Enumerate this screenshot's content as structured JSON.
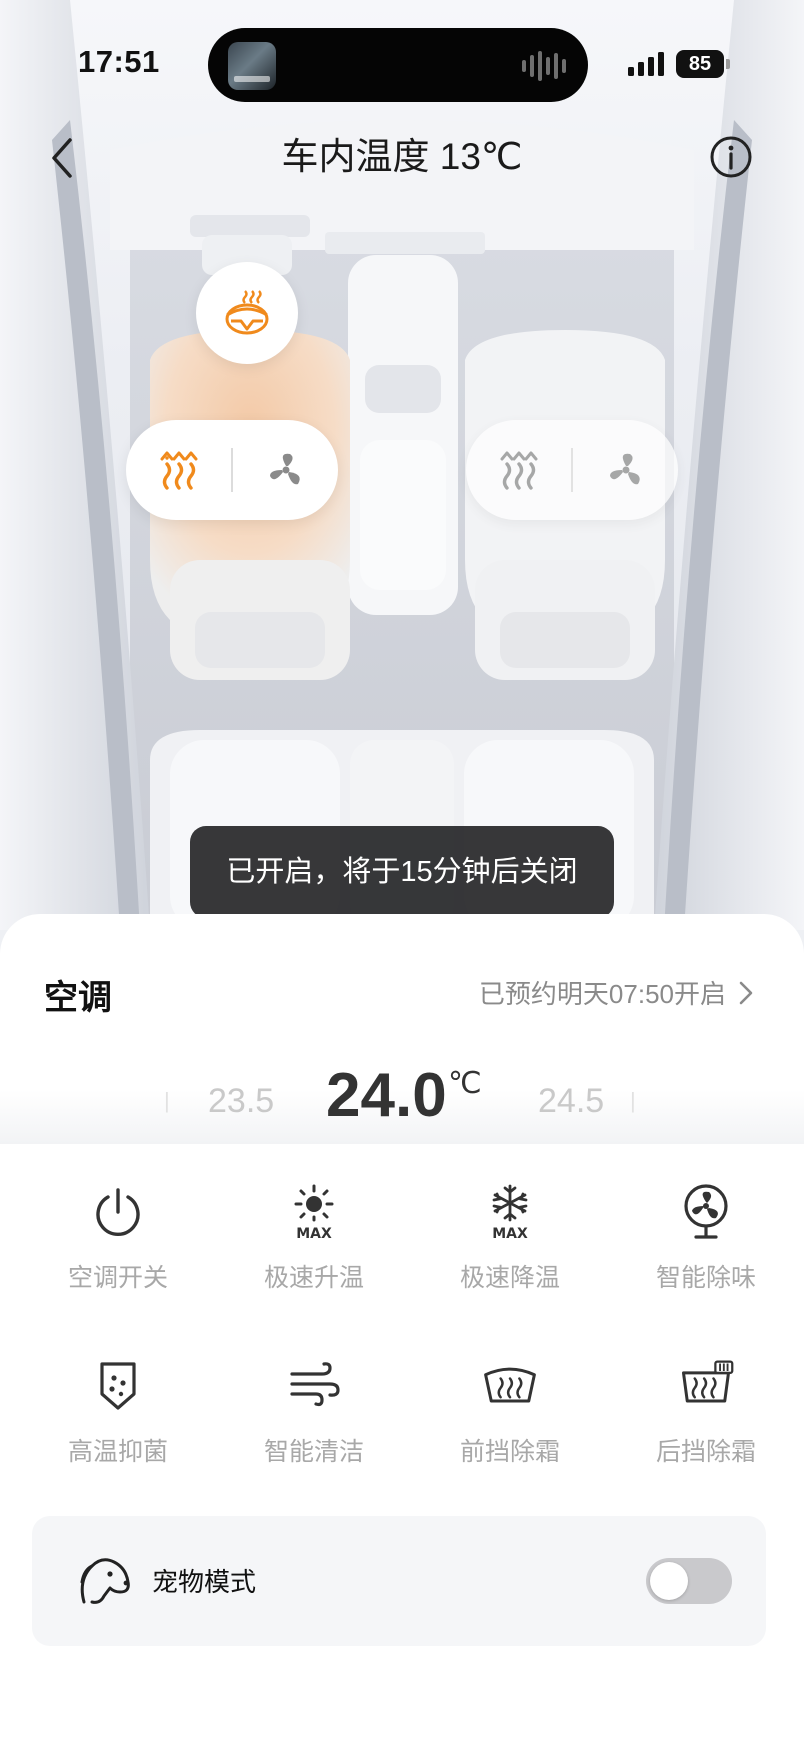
{
  "status_bar": {
    "time": "17:51",
    "battery": "85"
  },
  "header": {
    "title": "车内温度 13℃"
  },
  "toast": {
    "message": "已开启，将于15分钟后关闭"
  },
  "climate": {
    "title": "空调",
    "schedule_text": "已预约明天07:50开启",
    "temperature": {
      "current": "24.0",
      "unit": "℃",
      "lower": "23.5",
      "higher": "24.5"
    },
    "functions": [
      {
        "label": "空调开关",
        "icon": "power-icon"
      },
      {
        "label": "极速升温",
        "icon": "max-heat-icon"
      },
      {
        "label": "极速降温",
        "icon": "max-cool-icon"
      },
      {
        "label": "智能除味",
        "icon": "fan-deodorize-icon"
      },
      {
        "label": "高温抑菌",
        "icon": "sterilize-icon"
      },
      {
        "label": "智能清洁",
        "icon": "wind-clean-icon"
      },
      {
        "label": "前挡除霜",
        "icon": "front-defrost-icon"
      },
      {
        "label": "后挡除霜",
        "icon": "rear-defrost-icon"
      }
    ],
    "pet_mode": {
      "label": "宠物模式",
      "enabled": false
    }
  },
  "seats": {
    "steering_wheel_heat": "on",
    "driver": {
      "heat": "on",
      "ventilation": "off"
    },
    "passenger": {
      "heat": "off",
      "ventilation": "off"
    }
  },
  "colors": {
    "accent_orange": "#F08A1C",
    "icon_gray": "#333333",
    "label_gray": "#A8A8A8"
  }
}
